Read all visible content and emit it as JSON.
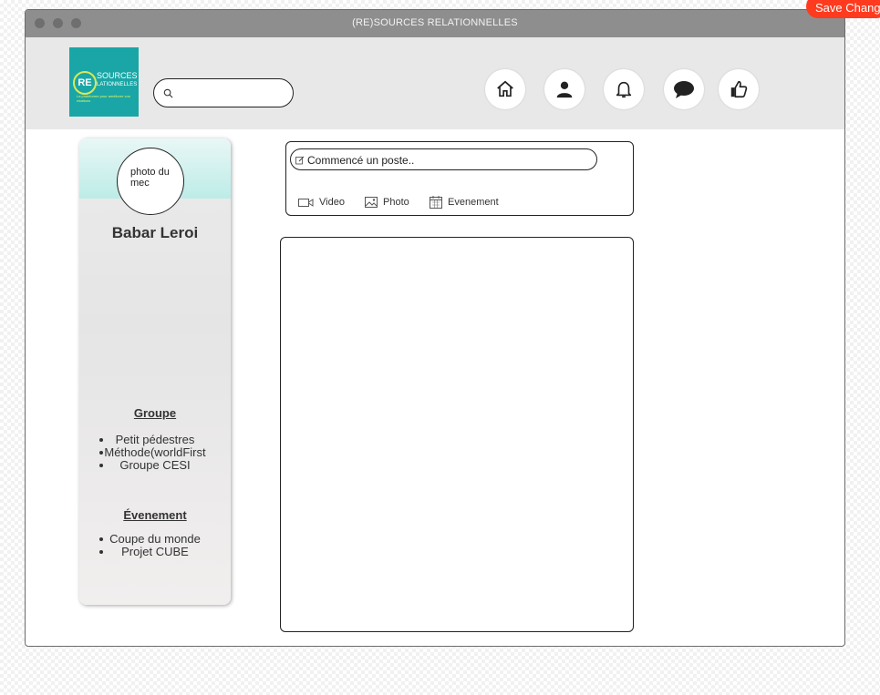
{
  "window": {
    "title": "(RE)SOURCES RELATIONNELLES"
  },
  "logo": {
    "re": "RE",
    "line1": "SOURCES",
    "line2": "LATIONNELLES",
    "tagline": "La plateforme pour améliorer vos relations"
  },
  "search": {
    "placeholder": "",
    "icon": "search-icon"
  },
  "nav": [
    {
      "icon": "home-icon"
    },
    {
      "icon": "user-icon"
    },
    {
      "icon": "bell-icon"
    },
    {
      "icon": "chat-icon"
    },
    {
      "icon": "thumbs-up-icon"
    }
  ],
  "profile": {
    "photo_label": "photo du mec",
    "name": "Babar Leroi",
    "groups_title": "Groupe",
    "groups": [
      "Petit pédestres",
      "Méthode(worldFirst",
      "Groupe CESI"
    ],
    "events_title": "Évenement",
    "events": [
      "Coupe du monde",
      "Projet CUBE"
    ]
  },
  "composer": {
    "placeholder": "Commencé un poste..",
    "actions": {
      "video": "Video",
      "photo": "Photo",
      "event": "Evenement"
    }
  },
  "save_button": "Save Change"
}
